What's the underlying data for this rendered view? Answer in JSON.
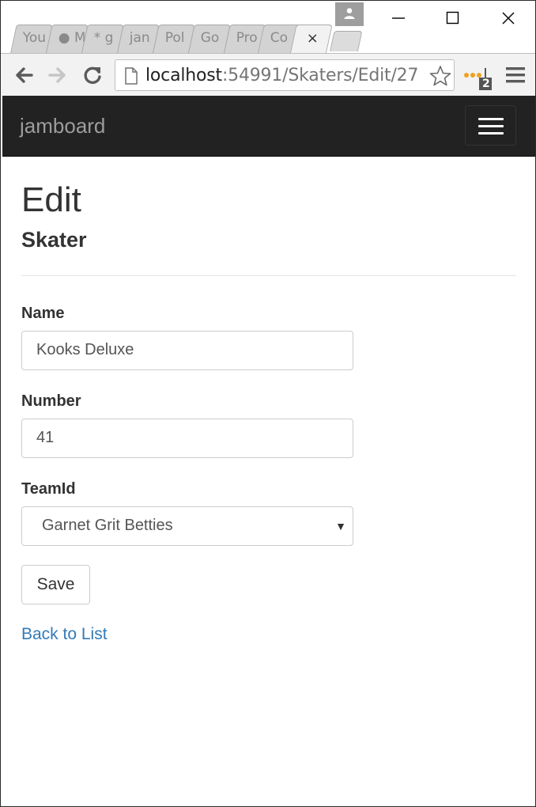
{
  "browser": {
    "tabs": [
      {
        "label": "You"
      },
      {
        "label": "● M"
      },
      {
        "label": "* g"
      },
      {
        "label": "jan"
      },
      {
        "label": "Pol"
      },
      {
        "label": "Go"
      },
      {
        "label": "Pro"
      },
      {
        "label": "Co"
      }
    ],
    "active_tab": {
      "close_glyph": "×"
    },
    "url": {
      "host": "localhost",
      "rest": ":54991/Skaters/Edit/27"
    },
    "extension_badge": "2"
  },
  "navbar": {
    "brand": "jamboard"
  },
  "page": {
    "title": "Edit",
    "subtitle": "Skater",
    "fields": {
      "name": {
        "label": "Name",
        "value": "Kooks Deluxe"
      },
      "number": {
        "label": "Number",
        "value": "41"
      },
      "team": {
        "label": "TeamId",
        "selected": "Garnet Grit Betties"
      }
    },
    "save_label": "Save",
    "back_link": "Back to List"
  },
  "colors": {
    "navbar_bg": "#222222",
    "link": "#337ab7",
    "brand_text": "#9d9d9d"
  }
}
